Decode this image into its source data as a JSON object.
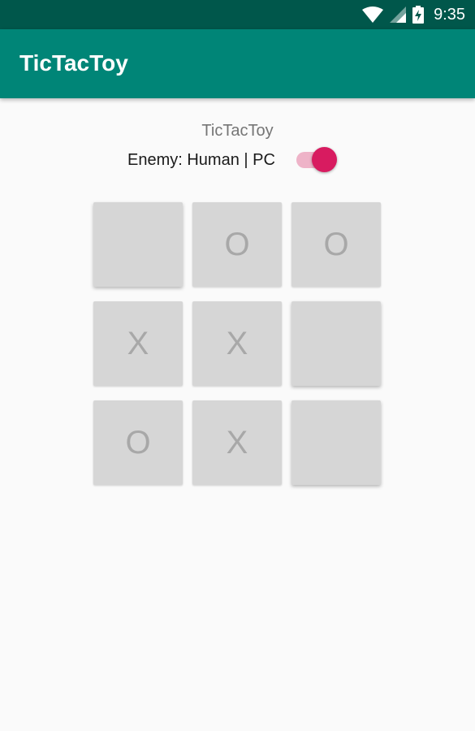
{
  "status_bar": {
    "time": "9:35",
    "icons": [
      "wifi-icon",
      "signal-icon",
      "battery-charging-icon"
    ]
  },
  "app_bar": {
    "title": "TicTacToy",
    "color": "#008577"
  },
  "game": {
    "title": "TicTacToy",
    "enemy_label": "Enemy: Human | PC",
    "enemy_switch_on": true,
    "accent_color": "#D81B60"
  },
  "board": {
    "cells": [
      "",
      "O",
      "O",
      "X",
      "X",
      "",
      "O",
      "X",
      ""
    ]
  }
}
